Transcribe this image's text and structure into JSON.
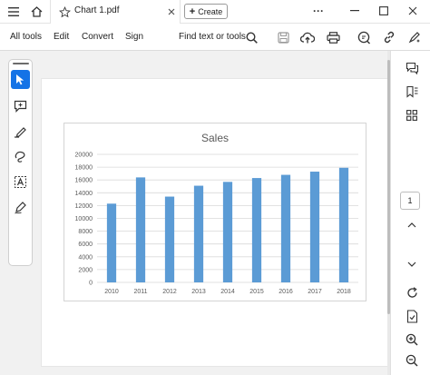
{
  "titlebar": {
    "document_tab": "Chart 1.pdf",
    "create_label": "Create",
    "more_label": "···"
  },
  "menubar": {
    "items": [
      "All tools",
      "Edit",
      "Convert",
      "Sign"
    ],
    "find_label": "Find text or tools"
  },
  "right_rail": {
    "page_number": "1"
  },
  "colors": {
    "accent": "#1473e6",
    "bar": "#5b9bd5"
  },
  "chart_data": {
    "type": "bar",
    "title": "Sales",
    "categories": [
      "2010",
      "2011",
      "2012",
      "2013",
      "2014",
      "2015",
      "2016",
      "2017",
      "2018"
    ],
    "values": [
      12300,
      16400,
      13400,
      15100,
      15700,
      16300,
      16800,
      17300,
      17900
    ],
    "yticks": [
      "0",
      "2000",
      "4000",
      "6000",
      "8000",
      "10000",
      "12000",
      "14000",
      "16000",
      "18000",
      "20000"
    ],
    "ylim": [
      0,
      20000
    ],
    "grid": true,
    "legend": "none"
  }
}
